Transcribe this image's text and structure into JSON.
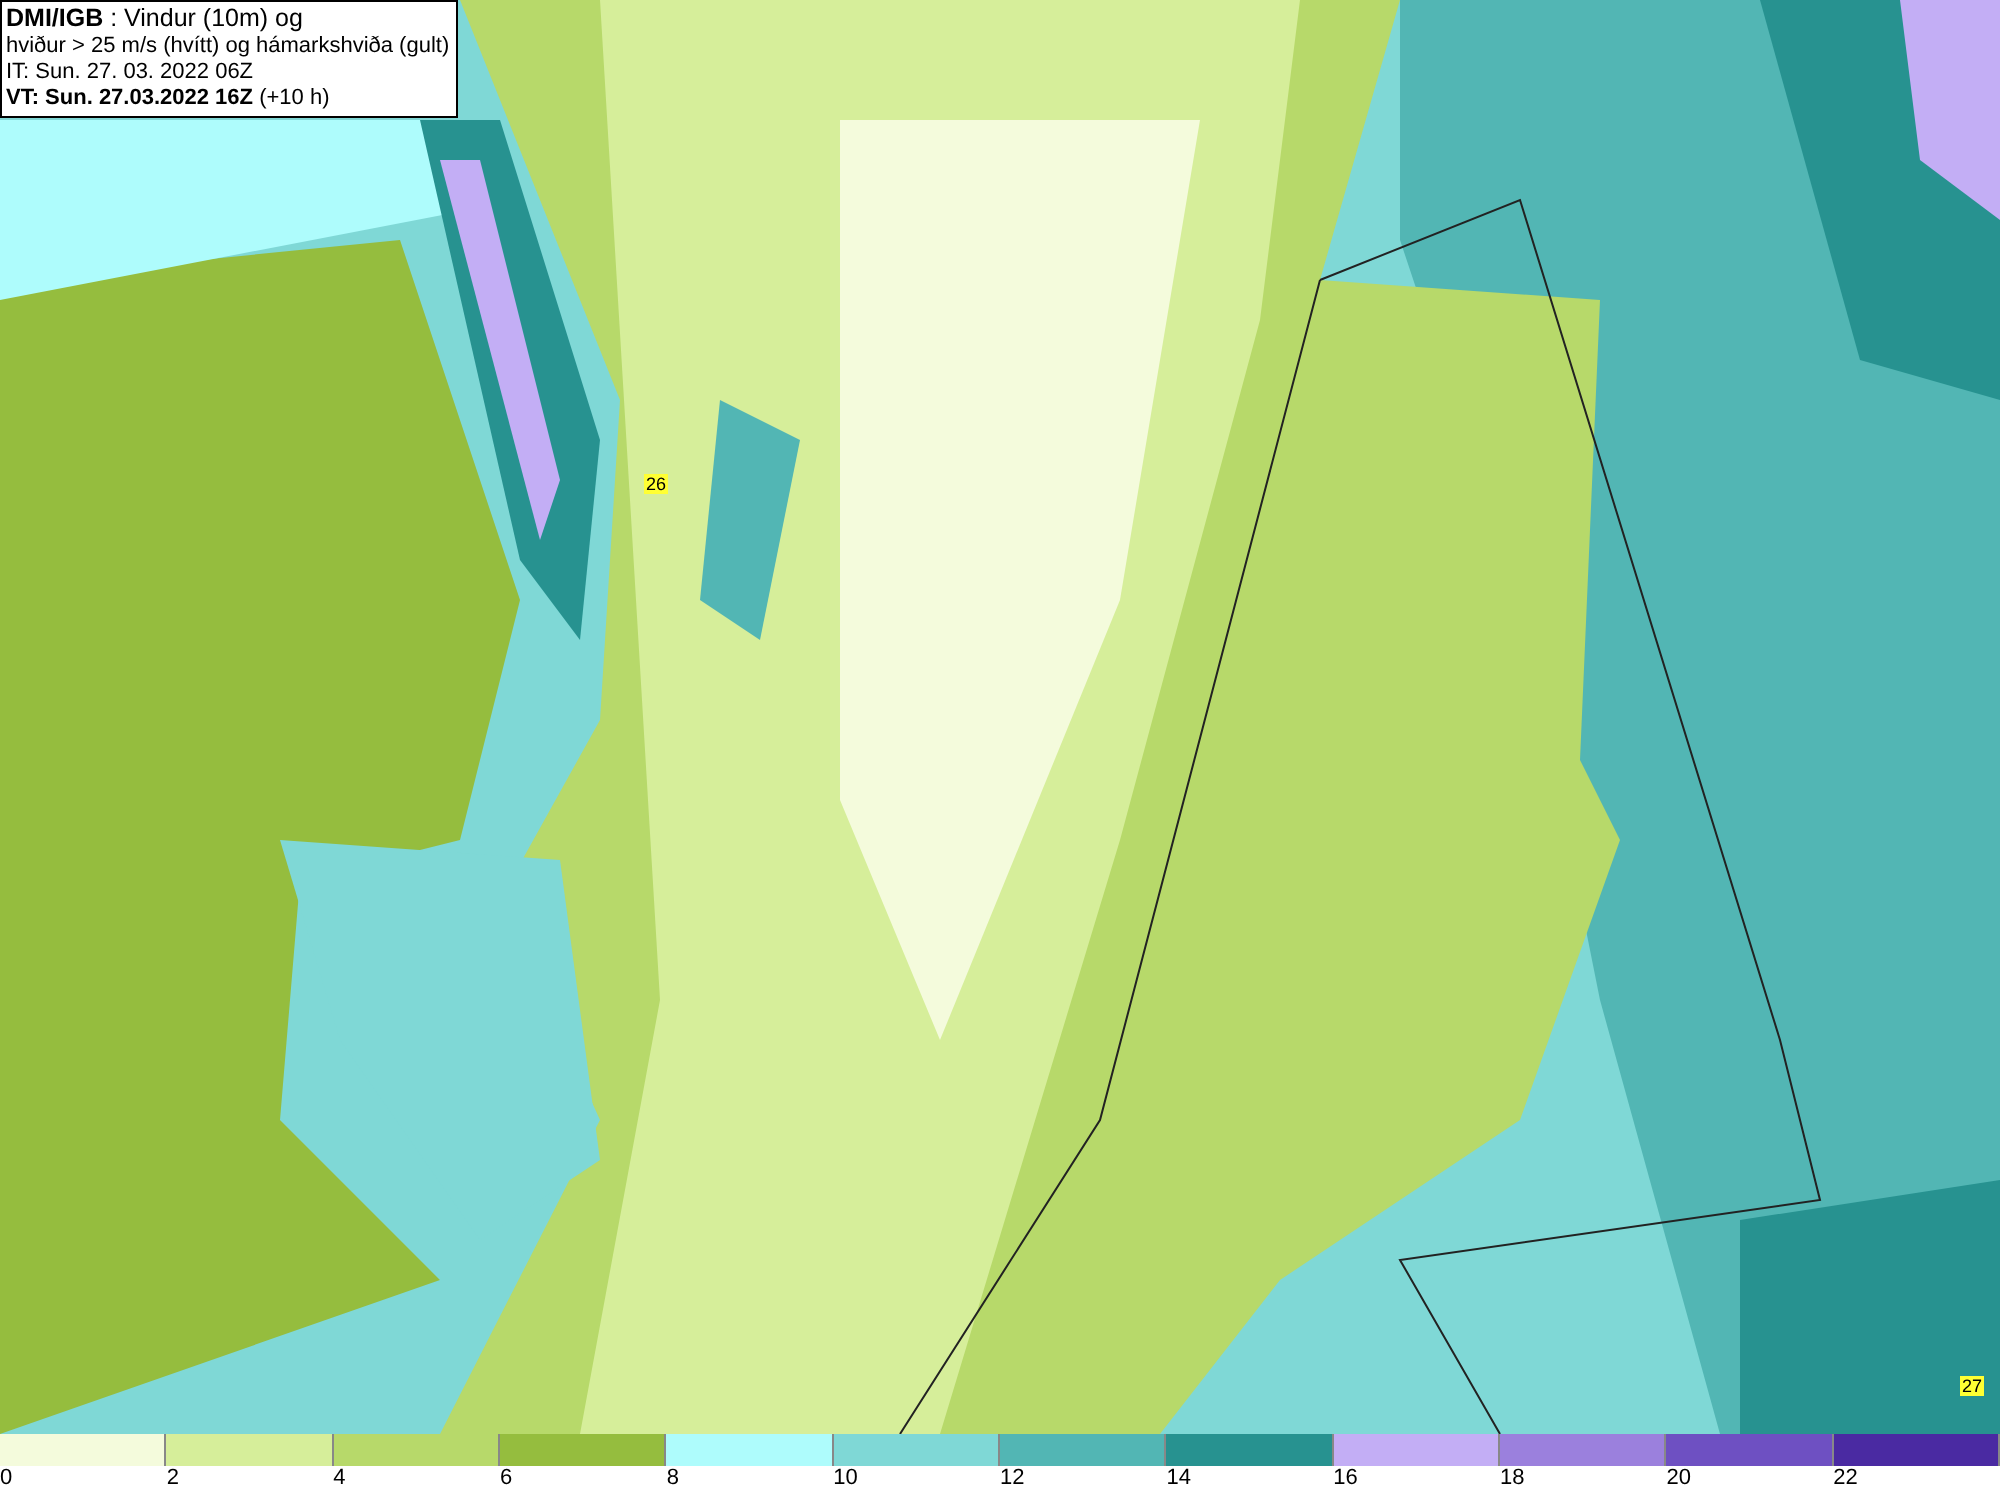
{
  "title_box": {
    "lines": [
      "**DMI/IGB** : Vindur (10m) og",
      "hviður > 25 m/s (hvítt) og hámarkshviða (gult)",
      "IT: Sun. 27. 03. 2022 06Z",
      "**VT: Sun. 27.03.2022 16Z** (+10 h)"
    ]
  },
  "map": {
    "gust_labels": [
      "26",
      "27"
    ]
  },
  "legend": [
    {
      "label": "0",
      "color": "#f4fbdc"
    },
    {
      "label": "2",
      "color": "#d6ee9a"
    },
    {
      "label": "4",
      "color": "#b7d96a"
    },
    {
      "label": "6",
      "color": "#95bd3e"
    },
    {
      "label": "8",
      "color": "#aefcfc"
    },
    {
      "label": "10",
      "color": "#7fd8d6"
    },
    {
      "label": "12",
      "color": "#52b6b4"
    },
    {
      "label": "14",
      "color": "#279290"
    },
    {
      "label": "16",
      "color": "#c3aef5"
    },
    {
      "label": "18",
      "color": "#9b80dd"
    },
    {
      "label": "20",
      "color": "#6e50c2"
    },
    {
      "label": "22",
      "color": "#4a2aa2"
    }
  ]
}
